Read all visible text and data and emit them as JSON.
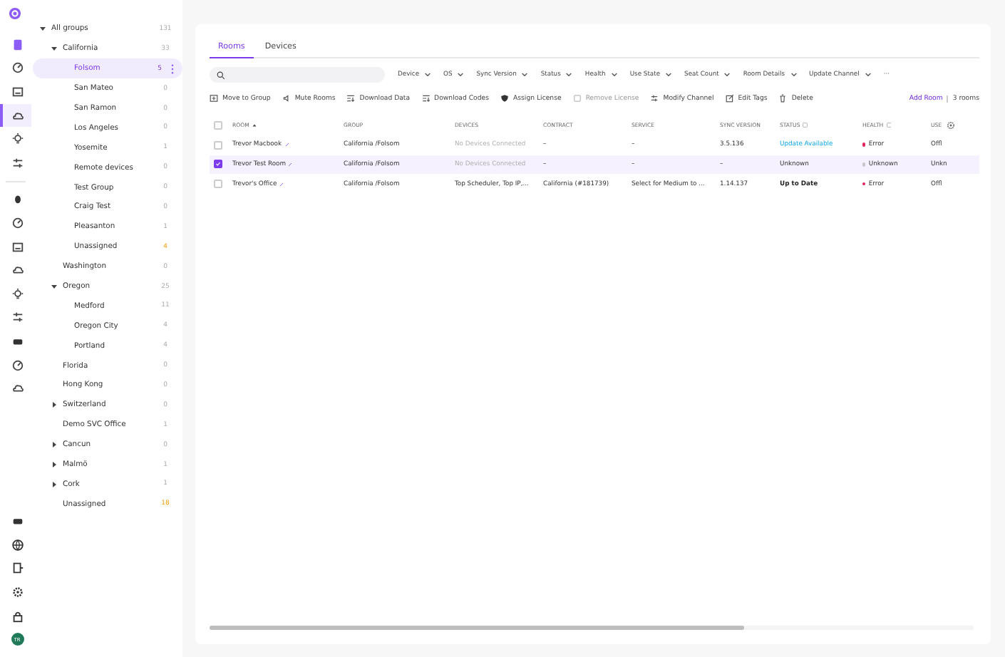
{
  "rail": {
    "top": [
      {
        "selected": false
      },
      {
        "selected": false
      },
      {
        "selected": false
      },
      {
        "selected": true
      },
      {
        "selected": false
      },
      {
        "selected": false
      }
    ],
    "middle": [
      {
        "selected": false
      },
      {
        "selected": false
      },
      {
        "selected": false
      },
      {
        "selected": false
      },
      {
        "selected": false
      },
      {
        "selected": false
      },
      {
        "selected": false
      },
      {
        "selected": false
      },
      {
        "selected": false
      }
    ],
    "bottom": [
      {
        "selected": false
      },
      {
        "selected": false
      },
      {
        "selected": false
      },
      {
        "selected": false
      },
      {
        "selected": false
      }
    ],
    "avatar": "TR"
  },
  "tree": [
    {
      "label": "All groups",
      "count": "131",
      "expanded": true,
      "selected": false,
      "alert": false,
      "children": [
        {
          "label": "California",
          "count": "33",
          "expanded": true,
          "selected": false,
          "alert": false,
          "children": [
            {
              "label": "Folsom",
              "count": "5",
              "selected": true,
              "alert": false
            },
            {
              "label": "San Mateo",
              "count": "0",
              "selected": false,
              "alert": false
            },
            {
              "label": "San Ramon",
              "count": "0",
              "selected": false,
              "alert": false
            },
            {
              "label": "Los Angeles",
              "count": "0",
              "selected": false,
              "alert": false
            },
            {
              "label": "Yosemite",
              "count": "1",
              "selected": false,
              "alert": false
            },
            {
              "label": "Remote devices",
              "count": "0",
              "selected": false,
              "alert": false
            },
            {
              "label": "Test Group",
              "count": "0",
              "selected": false,
              "alert": false
            },
            {
              "label": "Craig Test",
              "count": "0",
              "selected": false,
              "alert": false
            },
            {
              "label": "Pleasanton",
              "count": "1",
              "selected": false,
              "alert": false
            },
            {
              "label": "Unassigned",
              "count": "4",
              "selected": false,
              "alert": true
            }
          ]
        },
        {
          "label": "Washington",
          "count": "0",
          "selected": false,
          "alert": false
        },
        {
          "label": "Oregon",
          "count": "25",
          "expanded": true,
          "selected": false,
          "alert": false,
          "children": [
            {
              "label": "Medford",
              "count": "11",
              "selected": false,
              "alert": false
            },
            {
              "label": "Oregon City",
              "count": "4",
              "selected": false,
              "alert": false
            },
            {
              "label": "Portland",
              "count": "4",
              "selected": false,
              "alert": false
            }
          ]
        },
        {
          "label": "Florida",
          "count": "0",
          "selected": false,
          "alert": false
        },
        {
          "label": "Hong Kong",
          "count": "0",
          "selected": false,
          "alert": false
        },
        {
          "label": "Switzerland",
          "count": "0",
          "expanded": false,
          "selected": false,
          "alert": false
        },
        {
          "label": "Demo SVC Office",
          "count": "1",
          "selected": false,
          "alert": false
        },
        {
          "label": "Cancun",
          "count": "0",
          "expanded": false,
          "selected": false,
          "alert": false
        },
        {
          "label": "Malmö",
          "count": "1",
          "expanded": false,
          "selected": false,
          "alert": false
        },
        {
          "label": "Cork",
          "count": "1",
          "expanded": false,
          "selected": false,
          "alert": false
        },
        {
          "label": "Unassigned",
          "count": "18",
          "selected": false,
          "alert": true
        }
      ]
    }
  ],
  "tabs": [
    {
      "label": "Rooms",
      "selected": true
    },
    {
      "label": "Devices",
      "selected": false
    }
  ],
  "filters": [
    "Device",
    "OS",
    "Sync Version",
    "Status",
    "Health",
    "Use State",
    "Seat Count",
    "Room Details",
    "Update Channel"
  ],
  "more_filters": "···",
  "actions": [
    {
      "label": "Move to Group",
      "disabled": false
    },
    {
      "label": "Mute Rooms",
      "disabled": false
    },
    {
      "label": "Download Data",
      "disabled": false
    },
    {
      "label": "Download Codes",
      "disabled": false
    },
    {
      "label": "Assign License",
      "disabled": false
    },
    {
      "label": "Remove License",
      "disabled": true
    },
    {
      "label": "Modify Channel",
      "disabled": false
    },
    {
      "label": "Edit Tags",
      "disabled": false
    },
    {
      "label": "Delete",
      "disabled": false
    }
  ],
  "add_room": "Add Room",
  "room_count": "3 rooms",
  "table": {
    "all_selected": false,
    "columns": [
      "ROOM",
      "GROUP",
      "DEVICES",
      "CONTRACT",
      "SERVICE",
      "SYNC VERSION",
      "STATUS",
      "HEALTH",
      "USE"
    ],
    "rows": [
      {
        "selected": false,
        "room": "Trevor Macbook",
        "group": "California /Folsom",
        "devices": {
          "text": "No Devices Connected",
          "disabled": true
        },
        "contract": "–",
        "service": "–",
        "sync": "3.5.136",
        "status": {
          "text": "Update Available",
          "kind": "link"
        },
        "health": {
          "text": "Error",
          "color": "#e0245e"
        },
        "use": "Offl"
      },
      {
        "selected": true,
        "room": "Trevor Test Room",
        "group": "California /Folsom",
        "devices": {
          "text": "No Devices Connected",
          "disabled": true
        },
        "contract": "–",
        "service": "–",
        "sync": "–",
        "status": {
          "text": "Unknown",
          "kind": "plain"
        },
        "health": {
          "text": "Unknown",
          "color": "#c8c8cc"
        },
        "use": "Unkn"
      },
      {
        "selected": false,
        "room": "Trevor's Office",
        "group": "California /Folsom",
        "devices": {
          "text": "Top Scheduler, Top IP,...",
          "disabled": false
        },
        "contract": "California (#181739)",
        "service": "Select for Medium to ...",
        "sync": "1.14.137",
        "status": {
          "text": "Up to Date",
          "kind": "bold"
        },
        "health": {
          "text": "Error",
          "color": "#e0245e"
        },
        "use": "Offl"
      }
    ]
  }
}
